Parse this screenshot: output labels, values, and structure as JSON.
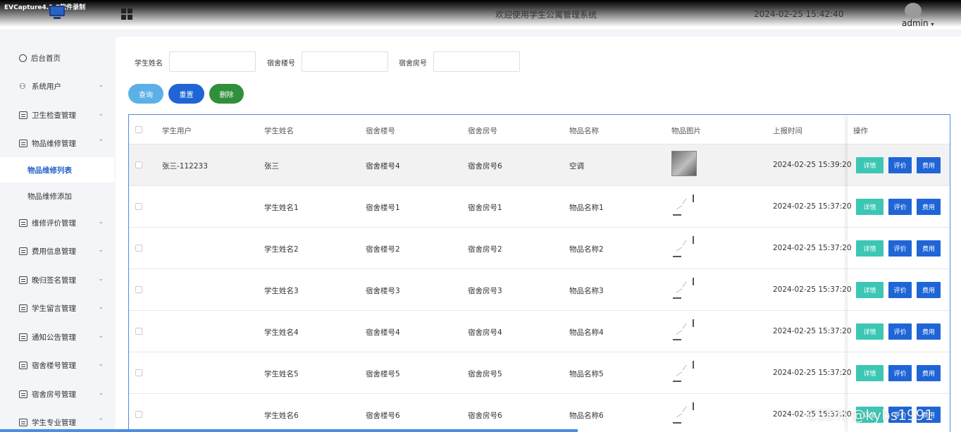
{
  "app": {
    "capture_title": "EVCapture4.1.8软件录制",
    "system_title": "欢迎使用学生公寓管理系统",
    "datetime": "2024-02-25 15:42:40",
    "user": "admin",
    "watermark": "CSDN @kybs1991"
  },
  "sidebar": {
    "items": [
      {
        "label": "后台首页",
        "icon": "clock-icon",
        "chevron": ""
      },
      {
        "label": "系统用户",
        "icon": "user-icon",
        "chevron": "⌄"
      },
      {
        "label": "卫生检查管理",
        "icon": "doc-icon",
        "chevron": "⌄"
      },
      {
        "label": "物品维修管理",
        "icon": "doc-icon",
        "chevron": "⌃"
      },
      {
        "label": "维修评价管理",
        "icon": "doc-icon",
        "chevron": "⌄"
      },
      {
        "label": "费用信息管理",
        "icon": "doc-icon",
        "chevron": "⌄"
      },
      {
        "label": "晚归签名管理",
        "icon": "doc-icon",
        "chevron": "⌄"
      },
      {
        "label": "学生留言管理",
        "icon": "doc-icon",
        "chevron": "⌄"
      },
      {
        "label": "通知公告管理",
        "icon": "doc-icon",
        "chevron": "⌄"
      },
      {
        "label": "宿舍楼号管理",
        "icon": "doc-icon",
        "chevron": "⌄"
      },
      {
        "label": "宿舍房号管理",
        "icon": "doc-icon",
        "chevron": "⌄"
      },
      {
        "label": "学生专业管理",
        "icon": "doc-icon",
        "chevron": "⌃"
      }
    ],
    "sub_items": [
      {
        "label": "物品维修列表",
        "active": true
      },
      {
        "label": "物品维修添加",
        "active": false
      }
    ]
  },
  "search": {
    "fields": [
      {
        "label": "学生姓名",
        "value": ""
      },
      {
        "label": "宿舍楼号",
        "value": ""
      },
      {
        "label": "宿舍房号",
        "value": ""
      }
    ],
    "buttons": {
      "query": "查询",
      "reset": "重置",
      "delete": "删除"
    },
    "colors": {
      "query": "#5bb0e8",
      "reset": "#1f65d6",
      "delete": "#2f8f3a"
    }
  },
  "table": {
    "headers": [
      "学生用户",
      "学生姓名",
      "宿舍楼号",
      "宿舍房号",
      "物品名称",
      "物品图片",
      "上报时间",
      "操作"
    ],
    "rows": [
      {
        "user": "张三-112233",
        "name": "张三",
        "building": "宿舍楼号4",
        "room": "宿舍房号6",
        "item": "空调",
        "image": "photo",
        "time": "2024-02-25 15:39:20"
      },
      {
        "user": "",
        "name": "学生姓名1",
        "building": "宿舍楼号1",
        "room": "宿舍房号1",
        "item": "物品名称1",
        "image": "loading",
        "time": "2024-02-25 15:37:20"
      },
      {
        "user": "",
        "name": "学生姓名2",
        "building": "宿舍楼号2",
        "room": "宿舍房号2",
        "item": "物品名称2",
        "image": "loading",
        "time": "2024-02-25 15:37:20"
      },
      {
        "user": "",
        "name": "学生姓名3",
        "building": "宿舍楼号3",
        "room": "宿舍房号3",
        "item": "物品名称3",
        "image": "loading",
        "time": "2024-02-25 15:37:20"
      },
      {
        "user": "",
        "name": "学生姓名4",
        "building": "宿舍楼号4",
        "room": "宿舍房号4",
        "item": "物品名称4",
        "image": "loading",
        "time": "2024-02-25 15:37:20"
      },
      {
        "user": "",
        "name": "学生姓名5",
        "building": "宿舍楼号5",
        "room": "宿舍房号5",
        "item": "物品名称5",
        "image": "loading",
        "time": "2024-02-25 15:37:20"
      },
      {
        "user": "",
        "name": "学生姓名6",
        "building": "宿舍楼号6",
        "room": "宿舍房号6",
        "item": "物品名称6",
        "image": "loading",
        "time": "2024-02-25 15:37:20"
      }
    ],
    "actions": {
      "detail": "详情",
      "evaluate": "评价",
      "fee": "费用"
    },
    "action_colors": {
      "detail": "#3cc7b4",
      "evaluate": "#1f65d6",
      "fee": "#1f65d6"
    }
  }
}
